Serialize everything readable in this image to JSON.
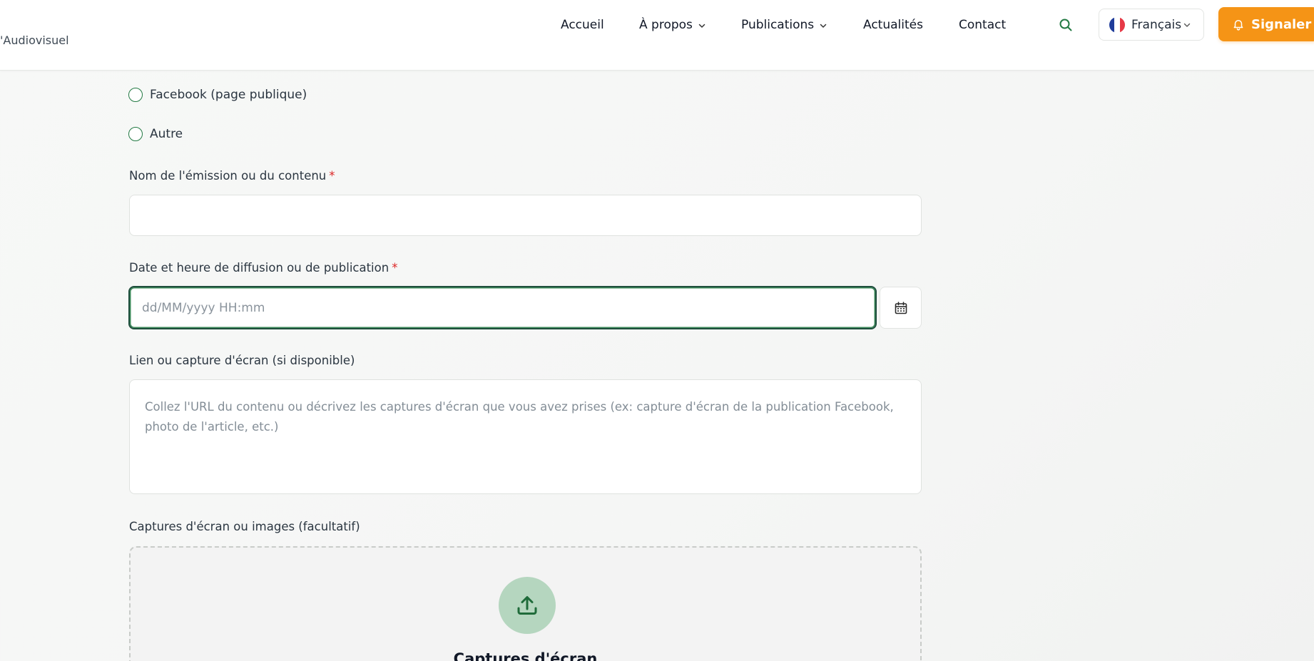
{
  "header": {
    "brand": "'Audiovisuel",
    "nav": [
      {
        "label": "Accueil",
        "has_dropdown": false
      },
      {
        "label": "À propos",
        "has_dropdown": true
      },
      {
        "label": "Publications",
        "has_dropdown": true
      },
      {
        "label": "Actualités",
        "has_dropdown": false
      },
      {
        "label": "Contact",
        "has_dropdown": false
      }
    ],
    "search_icon": "search-icon",
    "language": {
      "label": "Français",
      "flag": "fr-flag"
    },
    "report_button": {
      "label": "Signaler",
      "icon": "bell-icon"
    }
  },
  "form": {
    "source_options": [
      "Facebook (page publique)",
      "Autre"
    ],
    "content_name": {
      "label": "Nom de l'émission ou du contenu",
      "required_mark": "*",
      "value": ""
    },
    "broadcast_date": {
      "label": "Date et heure de diffusion ou de publication",
      "required_mark": "*",
      "placeholder": "dd/MM/yyyy HH:mm",
      "value": ""
    },
    "link_or_capture": {
      "label": "Lien ou capture d'écran (si disponible)",
      "placeholder": "Collez l'URL du contenu ou décrivez les captures d'écran que vous avez prises (ex: capture d'écran de la publication Facebook, photo de l'article, etc.)"
    },
    "screenshots": {
      "label": "Captures d'écran ou images (facultatif)",
      "dropzone_title": "Captures d'écran"
    }
  },
  "colors": {
    "accent_orange": "#f59416",
    "brand_green": "#237a43",
    "required_red": "#dc2626"
  }
}
